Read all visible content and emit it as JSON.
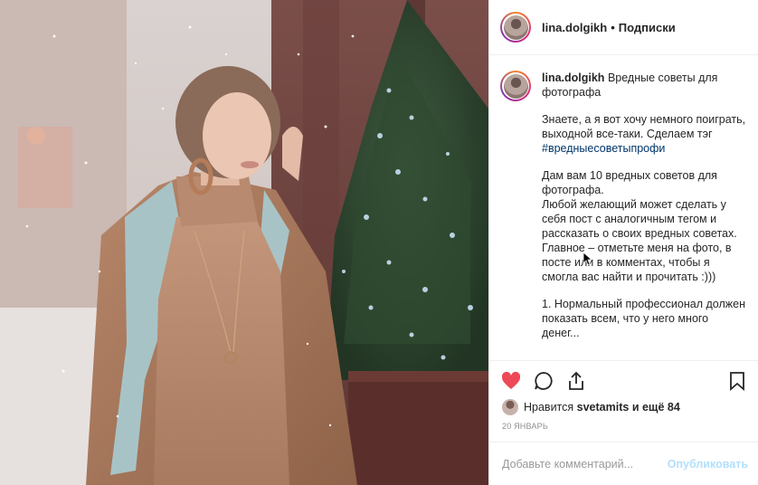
{
  "post": {
    "username": "lina.dolgikh",
    "dot": "•",
    "follow_status": "Подписки"
  },
  "caption": {
    "author": "lina.dolgikh",
    "title": "Вредные советы для фотографа",
    "para1": "Знаете, а я вот хочу немного поиграть, выходной все-таки. Сделаем тэг",
    "hashtag": "#вредныесоветыпрофи",
    "para2": "Дам вам 10 вредных советов для фотографа.\nЛюбой желающий может сделать у себя пост с аналогичным тегом и рассказать о своих вредных советах. Главное – отметьте меня на фото, в посте или в комментах, чтобы я смогла вас найти и прочитать :)))",
    "para3": "1. Нормальный профессионал должен показать всем, что у него много денег..."
  },
  "likes": {
    "prefix": "Нравится",
    "user": "svetamits",
    "suffix": "и ещё 84"
  },
  "date": "20 ЯНВАРЬ",
  "comment": {
    "placeholder": "Добавьте комментарий...",
    "publish_label": "Опубликовать"
  },
  "icons": {
    "like": "heart-icon",
    "comment": "comment-icon",
    "share": "share-icon",
    "save": "bookmark-icon"
  },
  "colors": {
    "like_active": "#ed4956",
    "hashtag": "#003569",
    "publish_disabled": "#b2dffc"
  }
}
